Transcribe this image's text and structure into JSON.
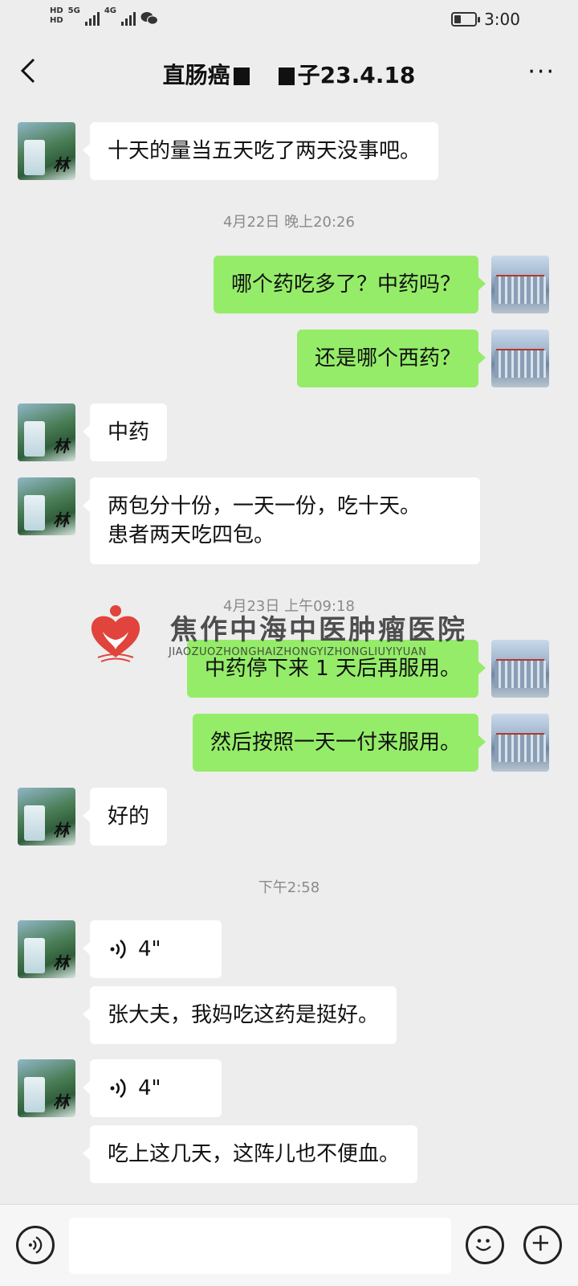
{
  "status_bar": {
    "hd1": "HD",
    "hd2": "HD",
    "net1": "5G",
    "net2": "4G",
    "time": "3:00"
  },
  "header": {
    "title_start": "直肠癌",
    "title_end": "子23.4.18",
    "back_icon": "chevron-left-icon",
    "more_icon": "more-icon"
  },
  "messages": [
    {
      "side": "in",
      "text": "十天的量当五天吃了两天没事吧。"
    },
    {
      "type": "timestamp",
      "text": "4月22日 晚上20:26"
    },
    {
      "side": "out",
      "text": "哪个药吃多了？中药吗？"
    },
    {
      "side": "out",
      "text": "还是哪个西药？"
    },
    {
      "side": "in",
      "text": "中药"
    },
    {
      "side": "in",
      "lines": [
        "两包分十份，一天一份，吃十天。",
        "患者两天吃四包。"
      ]
    },
    {
      "type": "timestamp",
      "text": "4月23日 上午09:18"
    },
    {
      "side": "out",
      "text": "中药停下来 1 天后再服用。"
    },
    {
      "side": "out",
      "text": "然后按照一天一付来服用。"
    },
    {
      "side": "in",
      "text": "好的"
    },
    {
      "type": "timestamp",
      "text": "下午2:58"
    },
    {
      "side": "in",
      "voice": "4\""
    },
    {
      "side": "in",
      "text": "张大夫，我妈吃这药是挺好。"
    },
    {
      "side": "in",
      "voice": "4\""
    },
    {
      "side": "in",
      "text": "吃上这几天，这阵儿也不便血。"
    }
  ],
  "avatars": {
    "contact_char": "林"
  },
  "watermark": {
    "name": "焦作中海中医肿瘤医院",
    "pinyin": "JIAOZUOZHONGHAIZHONGYIZHONGLIUYIYUAN"
  },
  "input_bar": {
    "placeholder": ""
  },
  "colors": {
    "background": "#ededed",
    "outgoing_bubble": "#95ec69",
    "incoming_bubble": "#ffffff",
    "timestamp": "#8a8a8a",
    "logo_red": "#e0443c"
  }
}
